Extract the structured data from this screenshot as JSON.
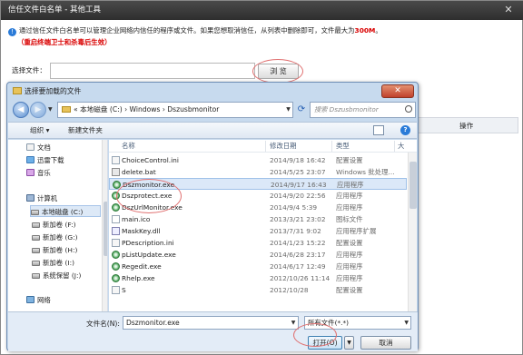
{
  "outer": {
    "title": "信任文件白名单 - 其他工具",
    "close_glyph": "✕",
    "info_icon": "!",
    "info_text_prefix": "通过信任文件白名单可以管理企业网络内信任的程序或文件。如果您想取消信任，从列表中删除即可，文件最大为",
    "info_max_size": "300M",
    "info_text_suffix": "。",
    "warning": "（重启终端卫士和杀毒后生效）",
    "choose_label": "选择文件：",
    "choose_value": "",
    "browse_label": "浏 览",
    "operation_header": "操作"
  },
  "dialog": {
    "title": "选择要加载的文件",
    "close_glyph": "✕",
    "address_prefix": "«",
    "address_path": "本地磁盘 (C:)  ›  Windows  ›  Dszusbmonitor",
    "search_placeholder": "搜索 Dszusbmonitor",
    "toolbar": {
      "organize": "组织 ▾",
      "new_folder": "新建文件夹",
      "help_glyph": "?"
    },
    "nav_items": [
      {
        "label": "文档",
        "icon": "document-icon"
      },
      {
        "label": "迅雷下载",
        "icon": "download-icon"
      },
      {
        "label": "音乐",
        "icon": "music-icon"
      },
      {
        "label": "计算机",
        "icon": "computer-icon"
      },
      {
        "label": "本地磁盘 (C:)",
        "icon": "drive-icon"
      },
      {
        "label": "新加卷 (F:)",
        "icon": "drive-icon"
      },
      {
        "label": "新加卷 (G:)",
        "icon": "drive-icon"
      },
      {
        "label": "新加卷 (H:)",
        "icon": "drive-icon"
      },
      {
        "label": "新加卷 (I:)",
        "icon": "drive-icon"
      },
      {
        "label": "系统保留 (J:)",
        "icon": "drive-icon"
      },
      {
        "label": "网络",
        "icon": "network-icon"
      }
    ],
    "columns": {
      "name": "名称",
      "date": "修改日期",
      "type": "类型",
      "size": "大"
    },
    "files": [
      {
        "name": "ChoiceControl.ini",
        "date": "2014/9/18 16:42",
        "type": "配置设置",
        "kind": "ini"
      },
      {
        "name": "delete.bat",
        "date": "2014/5/25 23:07",
        "type": "Windows 批处理...",
        "kind": "bat"
      },
      {
        "name": "Dszmonitor.exe",
        "date": "2014/9/17 16:43",
        "type": "应用程序",
        "kind": "exe",
        "selected": true
      },
      {
        "name": "Dszprotect.exe",
        "date": "2014/9/20 22:56",
        "type": "应用程序",
        "kind": "exe"
      },
      {
        "name": "DszUrlMonitor.exe",
        "date": "2014/9/4 5:39",
        "type": "应用程序",
        "kind": "exe"
      },
      {
        "name": "main.ico",
        "date": "2013/3/21 23:02",
        "type": "图标文件",
        "kind": "ico"
      },
      {
        "name": "MaskKey.dll",
        "date": "2013/7/31 9:02",
        "type": "应用程序扩展",
        "kind": "dll"
      },
      {
        "name": "PDescription.ini",
        "date": "2014/1/23 15:22",
        "type": "配置设置",
        "kind": "ini"
      },
      {
        "name": "pListUpdate.exe",
        "date": "2014/6/28 23:17",
        "type": "应用程序",
        "kind": "exe"
      },
      {
        "name": "Regedit.exe",
        "date": "2014/6/17 12:49",
        "type": "应用程序",
        "kind": "exe"
      },
      {
        "name": "Rhelp.exe",
        "date": "2012/10/26 11:14",
        "type": "应用程序",
        "kind": "exe"
      },
      {
        "name": "S",
        "date": "2012/10/28",
        "type": "配置设置",
        "kind": "ini"
      }
    ],
    "filename_label": "文件名(N):",
    "filename_value": "Dszmonitor.exe",
    "filetype_value": "所有文件(*.*)",
    "open_label": "打开(O)",
    "cancel_label": "取消"
  },
  "colors": {
    "accent_red": "#d90000",
    "selection": "#dbe8f8",
    "dialog_frame": "#c7daee"
  }
}
